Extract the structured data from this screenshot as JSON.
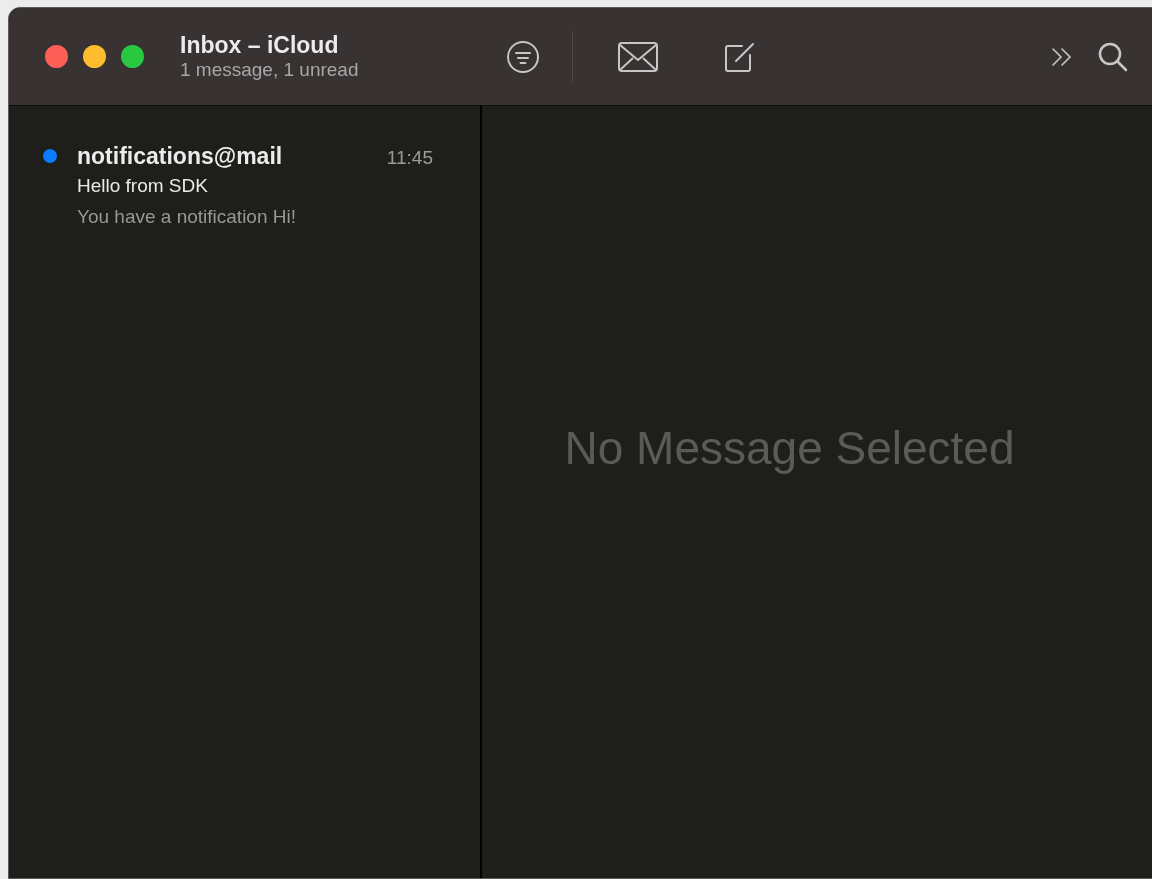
{
  "window": {
    "title": "Inbox – iCloud",
    "subtitle": "1 message, 1 unread"
  },
  "messages": [
    {
      "sender": "notifications@mail",
      "time": "11:45",
      "subject": "Hello from SDK",
      "preview": "You have a notification Hi!",
      "unread": true
    }
  ],
  "viewer": {
    "empty_text": "No Message Selected"
  }
}
